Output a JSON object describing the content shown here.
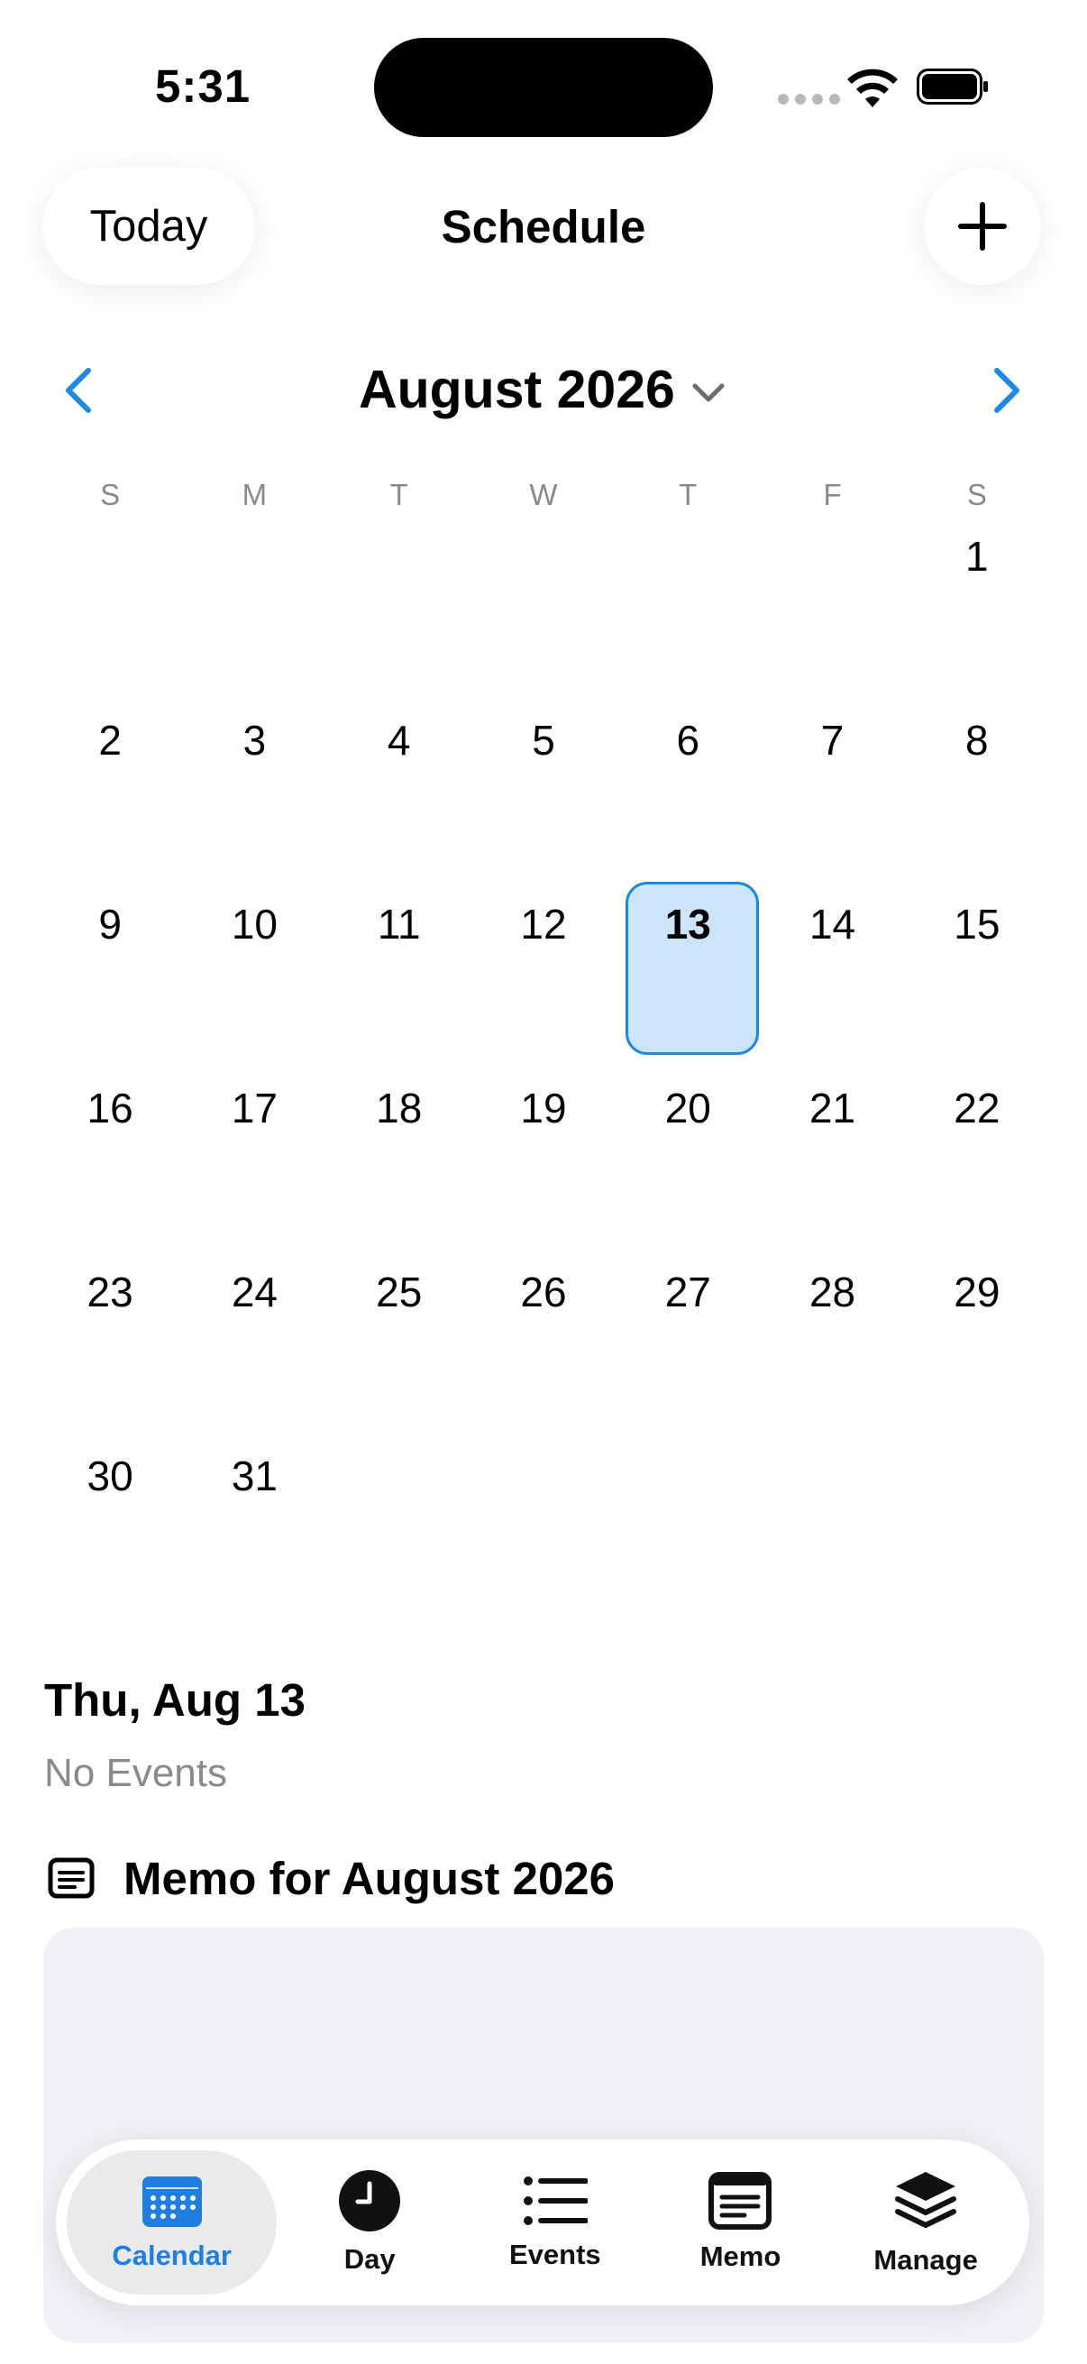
{
  "status": {
    "time": "5:31"
  },
  "header": {
    "today_label": "Today",
    "title": "Schedule",
    "add_icon": "plus-icon"
  },
  "calendar": {
    "month_title": "August 2026",
    "weekdays": [
      "S",
      "M",
      "T",
      "W",
      "T",
      "F",
      "S"
    ],
    "days": [
      "",
      "",
      "",
      "",
      "",
      "",
      "1",
      "2",
      "3",
      "4",
      "5",
      "6",
      "7",
      "8",
      "9",
      "10",
      "11",
      "12",
      "13",
      "14",
      "15",
      "16",
      "17",
      "18",
      "19",
      "20",
      "21",
      "22",
      "23",
      "24",
      "25",
      "26",
      "27",
      "28",
      "29",
      "30",
      "31",
      "",
      "",
      "",
      "",
      ""
    ],
    "selected_day": "13",
    "accent_color": "#1e88e5"
  },
  "day_info": {
    "date_label": "Thu, Aug 13",
    "events_status": "No Events"
  },
  "memo": {
    "title": "Memo for August 2026"
  },
  "tabbar": {
    "tabs": [
      {
        "label": "Calendar",
        "icon": "calendar-icon",
        "active": true
      },
      {
        "label": "Day",
        "icon": "clock-icon",
        "active": false
      },
      {
        "label": "Events",
        "icon": "list-icon",
        "active": false
      },
      {
        "label": "Memo",
        "icon": "memo-icon",
        "active": false
      },
      {
        "label": "Manage",
        "icon": "layers-icon",
        "active": false
      }
    ]
  }
}
